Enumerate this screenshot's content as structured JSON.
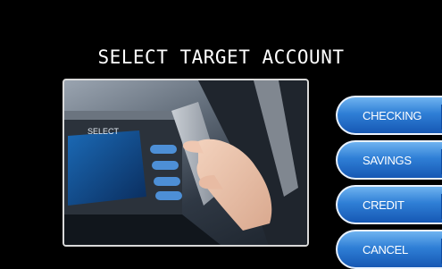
{
  "screen": {
    "title": "SELECT TARGET ACCOUNT",
    "photo": {
      "atm_label": "SELECT"
    }
  },
  "options": [
    {
      "label": "CHECKING"
    },
    {
      "label": "SAVINGS"
    },
    {
      "label": "CREDIT"
    },
    {
      "label": "CANCEL"
    }
  ],
  "colors": {
    "background": "#000000",
    "button_top": "#6fb3f0",
    "button_bottom": "#1658b4",
    "button_border": "#e9f2ff",
    "title_text": "#ffffff"
  }
}
